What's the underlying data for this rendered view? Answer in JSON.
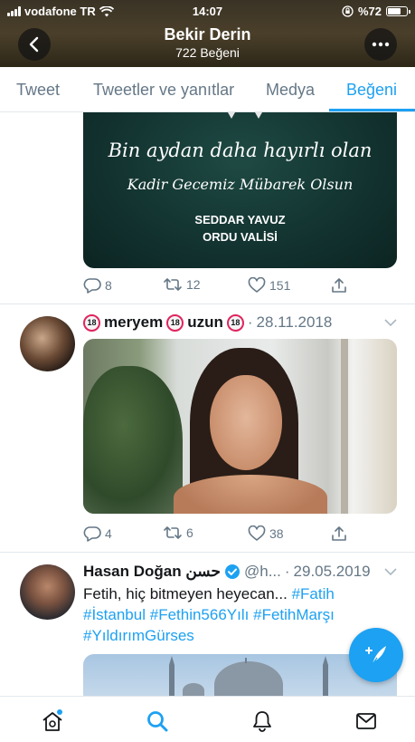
{
  "status_bar": {
    "carrier": "vodafone TR",
    "time": "14:07",
    "battery": "%72",
    "battery_level": 0.72
  },
  "header": {
    "name": "Bekir Derin",
    "subtitle": "722 Beğeni"
  },
  "tabs": [
    {
      "label": "Tweet",
      "active": false
    },
    {
      "label": "Tweetler ve yanıtlar",
      "active": false
    },
    {
      "label": "Medya",
      "active": false
    },
    {
      "label": "Beğeni",
      "active": true
    }
  ],
  "tweets": [
    {
      "image": {
        "line1": "Bin aydan daha hayırlı olan",
        "line2": "Kadir Gecemiz Mübarek Olsun",
        "sign1": "SEDDAR YAVUZ",
        "sign2": "ORDU VALİSİ"
      },
      "replies": "8",
      "retweets": "12",
      "likes": "151"
    },
    {
      "name_part1": "meryem",
      "name_part2": "uzun",
      "badge": "18",
      "separator": "·",
      "date": "28.11.2018",
      "replies": "4",
      "retweets": "6",
      "likes": "38"
    },
    {
      "name": "Hasan Doğan حسن",
      "handle": "@h...",
      "separator": "·",
      "date": "29.05.2019",
      "text": "Fetih, hiç bitmeyen heyecan...",
      "hashtags": [
        "#Fatih",
        "#İstanbul",
        "#Fethin566Yılı",
        "#FetihMarşı",
        "#YıldırımGürses"
      ]
    }
  ],
  "colors": {
    "accent": "#1da1f2",
    "secondary_text": "#657786",
    "border": "#e1e8ed"
  },
  "icons": [
    "back-icon",
    "more-icon",
    "reply-icon",
    "retweet-icon",
    "like-icon",
    "share-icon",
    "home-icon",
    "search-icon",
    "notifications-icon",
    "messages-icon",
    "compose-icon",
    "verified-icon"
  ]
}
